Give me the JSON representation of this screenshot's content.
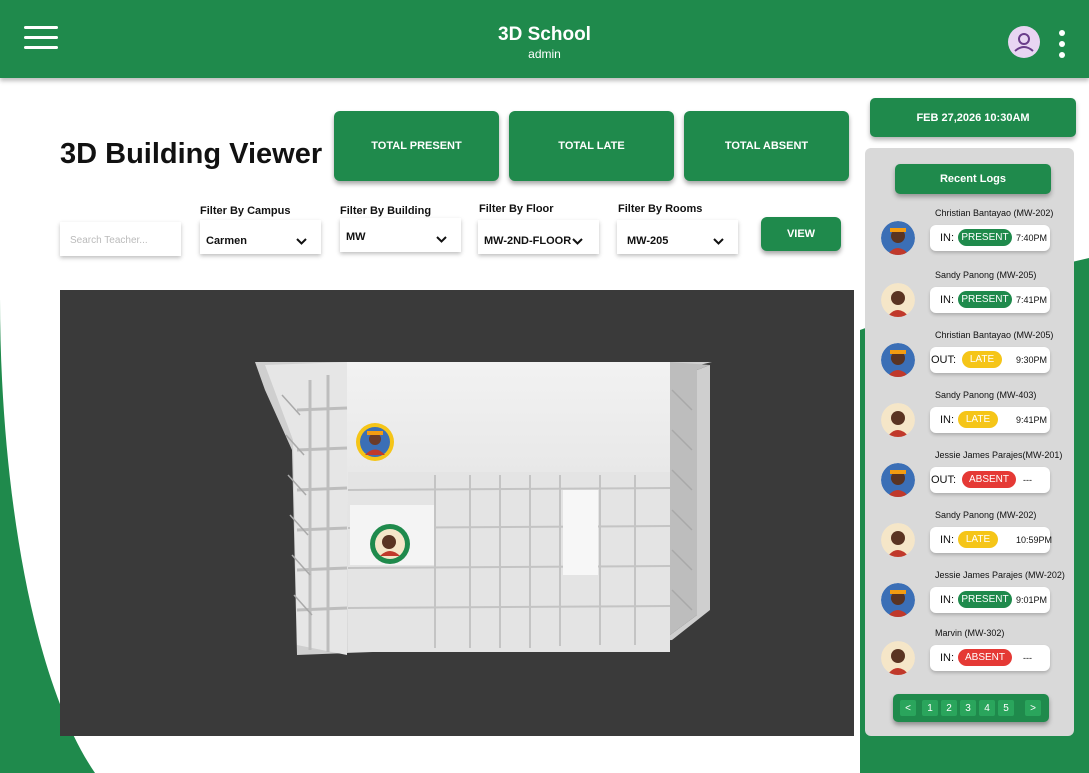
{
  "header": {
    "app_title": "3D School",
    "app_subtitle": "admin",
    "menu_icon": "hamburger-menu-icon",
    "profile_icon": "user-avatar-icon",
    "more_icon": "kebab-menu-icon"
  },
  "page": {
    "title": "3D Building Viewer"
  },
  "stats": [
    {
      "label": "TOTAL PRESENT"
    },
    {
      "label": "TOTAL LATE"
    },
    {
      "label": "TOTAL ABSENT"
    }
  ],
  "filters": {
    "search_placeholder": "Search Teacher...",
    "campus": {
      "label": "Filter By Campus",
      "value": "Carmen"
    },
    "building": {
      "label": "Filter By Building",
      "value": "MW"
    },
    "floor": {
      "label": "Filter By Floor",
      "value": "MW-2ND-FLOOR"
    },
    "rooms": {
      "label": "Filter By Rooms",
      "value": "MW-205"
    },
    "view_label": "VIEW"
  },
  "datetime": "FEB 27,2026 10:30AM",
  "logs": {
    "title": "Recent Logs",
    "items": [
      {
        "name": "Christian Bantayao (MW-202)",
        "direction": "IN:",
        "status": "PRESENT",
        "time": "7:40PM",
        "person": "a"
      },
      {
        "name": "Sandy Panong (MW-205)",
        "direction": "IN:",
        "status": "PRESENT",
        "time": "7:41PM",
        "person": "b"
      },
      {
        "name": "Christian Bantayao (MW-205)",
        "direction": "OUT:",
        "status": "LATE",
        "time": "9:30PM",
        "person": "a"
      },
      {
        "name": "Sandy Panong (MW-403)",
        "direction": "IN:",
        "status": "LATE",
        "time": "9:41PM",
        "person": "b"
      },
      {
        "name": "Jessie James Parajes(MW-201)",
        "direction": "OUT:",
        "status": "ABSENT",
        "time": "---",
        "person": "a"
      },
      {
        "name": "Sandy Panong  (MW-202)",
        "direction": "IN:",
        "status": "LATE",
        "time": "10:59PM",
        "person": "b"
      },
      {
        "name": "Jessie James Parajes (MW-202)",
        "direction": "IN:",
        "status": "PRESENT",
        "time": "9:01PM",
        "person": "a"
      },
      {
        "name": "Marvin (MW-302)",
        "direction": "IN:",
        "status": "ABSENT",
        "time": "---",
        "person": "b"
      }
    ],
    "pager": [
      "<",
      "1",
      "2",
      "3",
      "4",
      "5",
      ">"
    ]
  },
  "colors": {
    "brand": "#1f8a4c",
    "present": "#1f8a4c",
    "late": "#f5c518",
    "absent": "#e53935",
    "viewer_bg": "#3a3a3a"
  }
}
